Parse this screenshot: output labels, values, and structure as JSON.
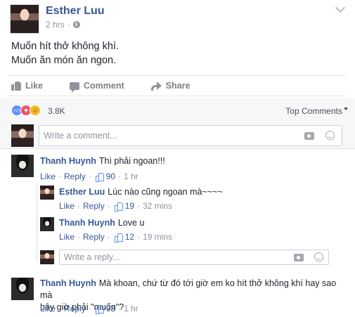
{
  "post": {
    "author": "Esther Luu",
    "time": "2 hrs",
    "separator": "·",
    "lines": [
      "Muốn hít thở không khí.",
      "Muốn ăn món ăn ngon."
    ]
  },
  "actions": {
    "like": "Like",
    "comment": "Comment",
    "share": "Share"
  },
  "reactions": {
    "count": "3.8K",
    "types": [
      "like",
      "love",
      "haha"
    ]
  },
  "sort": {
    "label": "Top Comments"
  },
  "composer": {
    "placeholder": "Write a comment..."
  },
  "reply_composer": {
    "placeholder": "Write a reply..."
  },
  "comments": [
    {
      "author": "Thanh Huynh",
      "text": "Thì phải ngoan!!!",
      "like": "Like",
      "reply": "Reply",
      "likes": "90",
      "time": "1 hr"
    },
    {
      "author": "Esther Luu",
      "text": "Lúc nào cũng ngoan mà~~~~",
      "like": "Like",
      "reply": "Reply",
      "likes": "19",
      "time": "32 mins"
    },
    {
      "author": "Thanh Huynh",
      "text": "Love u",
      "like": "Like",
      "reply": "Reply",
      "likes": "12",
      "time": "19 mins"
    },
    {
      "author": "Thanh Huynh",
      "text_line1": "Mà khoan, chứ từ đó tới giờ em ko hít thở không khí hay sao mà",
      "text_line2": "bây giờ phải \"muốn\"?",
      "like": "Like",
      "reply": "Reply",
      "likes": "93",
      "time": "1 hr"
    }
  ],
  "meta_dot": "·",
  "colors": {
    "link": "#365899",
    "muted": "#90949c",
    "text": "#1d2129",
    "bar": "#f6f7f9"
  }
}
